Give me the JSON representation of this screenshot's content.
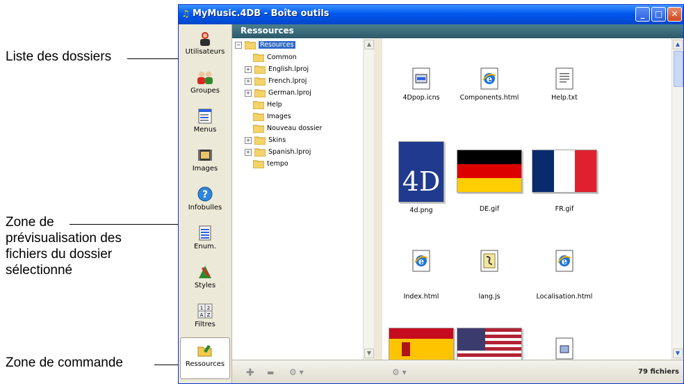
{
  "annotations": {
    "folder_list": "Liste des dossiers",
    "preview_zone_lines": [
      "Zone de",
      "prévisualisation des",
      "fichiers du dossier",
      "sélectionné"
    ],
    "command_zone": "Zone de commande"
  },
  "window": {
    "title": "MyMusic.4DB - Boîte outils",
    "header": "Ressources",
    "buttons": [
      "minimize",
      "maximize",
      "close"
    ]
  },
  "toolbar": {
    "items": [
      {
        "label": "Utilisateurs",
        "icon": "user-icon"
      },
      {
        "label": "Groupes",
        "icon": "group-icon"
      },
      {
        "label": "Menus",
        "icon": "menu-icon"
      },
      {
        "label": "Images",
        "icon": "image-icon"
      },
      {
        "label": "Infobulles",
        "icon": "help-bubble-icon"
      },
      {
        "label": "Enum.",
        "icon": "list-icon"
      },
      {
        "label": "Styles",
        "icon": "style-icon"
      },
      {
        "label": "Filtres",
        "icon": "filter-icon"
      },
      {
        "label": "Ressources",
        "icon": "resources-icon",
        "active": true
      }
    ]
  },
  "tree": {
    "nodes": [
      {
        "label": "Resources",
        "level": 0,
        "expander": "−",
        "selected": true
      },
      {
        "label": "Common",
        "level": 1,
        "expander": ""
      },
      {
        "label": "English.lproj",
        "level": 1,
        "expander": "+"
      },
      {
        "label": "French.lproj",
        "level": 1,
        "expander": "+"
      },
      {
        "label": "German.lproj",
        "level": 1,
        "expander": "+"
      },
      {
        "label": "Help",
        "level": 1,
        "expander": ""
      },
      {
        "label": "Images",
        "level": 1,
        "expander": ""
      },
      {
        "label": "Nouveau dossier",
        "level": 1,
        "expander": ""
      },
      {
        "label": "Skins",
        "level": 1,
        "expander": "+"
      },
      {
        "label": "Spanish.lproj",
        "level": 1,
        "expander": "+"
      },
      {
        "label": "tempo",
        "level": 1,
        "expander": ""
      }
    ]
  },
  "preview": {
    "files": [
      {
        "name": "4Dpop.icns",
        "kind": "icns-file-icon"
      },
      {
        "name": "Components.html",
        "kind": "html-file-icon"
      },
      {
        "name": "Help.txt",
        "kind": "text-file-icon"
      },
      {
        "name": "4d.png",
        "kind": "4d-logo-thumbnail",
        "thumb_text": "4D"
      },
      {
        "name": "DE.gif",
        "kind": "german-flag-thumbnail"
      },
      {
        "name": "FR.gif",
        "kind": "french-flag-thumbnail"
      },
      {
        "name": "Index.html",
        "kind": "html-file-icon"
      },
      {
        "name": "lang.js",
        "kind": "script-file-icon"
      },
      {
        "name": "Localisation.html",
        "kind": "html-file-icon"
      },
      {
        "name": "",
        "kind": "spanish-flag-thumbnail"
      },
      {
        "name": "",
        "kind": "us-flag-thumbnail"
      },
      {
        "name": "",
        "kind": "generic-file-icon"
      }
    ]
  },
  "command_bar": {
    "add": "✚",
    "remove": "▬",
    "gear": "⚙ ▾",
    "file_count": "79 fichiers"
  },
  "colors": {
    "title_blue": "#0058ee",
    "header_teal": "#2c5a6a",
    "selection": "#316ac5"
  }
}
